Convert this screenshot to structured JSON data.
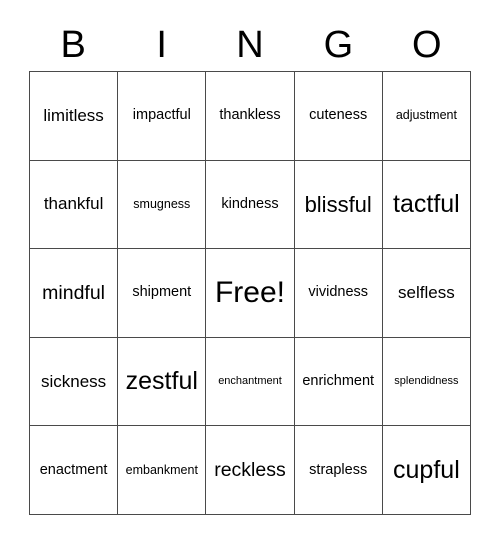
{
  "card": {
    "header_letters": [
      "B",
      "I",
      "N",
      "G",
      "O"
    ],
    "columns": 5,
    "rows": 5,
    "free_space_label": "Free!",
    "free_space_position": {
      "row": 3,
      "column": 3
    },
    "border_color": "#4a4a4a",
    "text_color": "#000000",
    "background_color": "#ffffff",
    "grid": [
      [
        {
          "text": "limitless",
          "size": "l"
        },
        {
          "text": "impactful",
          "size": "m"
        },
        {
          "text": "thankless",
          "size": "m"
        },
        {
          "text": "cuteness",
          "size": "m"
        },
        {
          "text": "adjustment",
          "size": "s"
        }
      ],
      [
        {
          "text": "thankful",
          "size": "l"
        },
        {
          "text": "smugness",
          "size": "s"
        },
        {
          "text": "kindness",
          "size": "m"
        },
        {
          "text": "blissful",
          "size": "xxl"
        },
        {
          "text": "tactful",
          "size": "3xl"
        }
      ],
      [
        {
          "text": "mindful",
          "size": "xl"
        },
        {
          "text": "shipment",
          "size": "m"
        },
        {
          "text": "Free!",
          "size": "4xl"
        },
        {
          "text": "vividness",
          "size": "m"
        },
        {
          "text": "selfless",
          "size": "l"
        }
      ],
      [
        {
          "text": "sickness",
          "size": "l"
        },
        {
          "text": "zestful",
          "size": "3xl"
        },
        {
          "text": "enchantment",
          "size": "xs"
        },
        {
          "text": "enrichment",
          "size": "m"
        },
        {
          "text": "splendidness",
          "size": "xs"
        }
      ],
      [
        {
          "text": "enactment",
          "size": "m"
        },
        {
          "text": "embankment",
          "size": "s"
        },
        {
          "text": "reckless",
          "size": "xl"
        },
        {
          "text": "strapless",
          "size": "m"
        },
        {
          "text": "cupful",
          "size": "3xl"
        }
      ]
    ]
  }
}
